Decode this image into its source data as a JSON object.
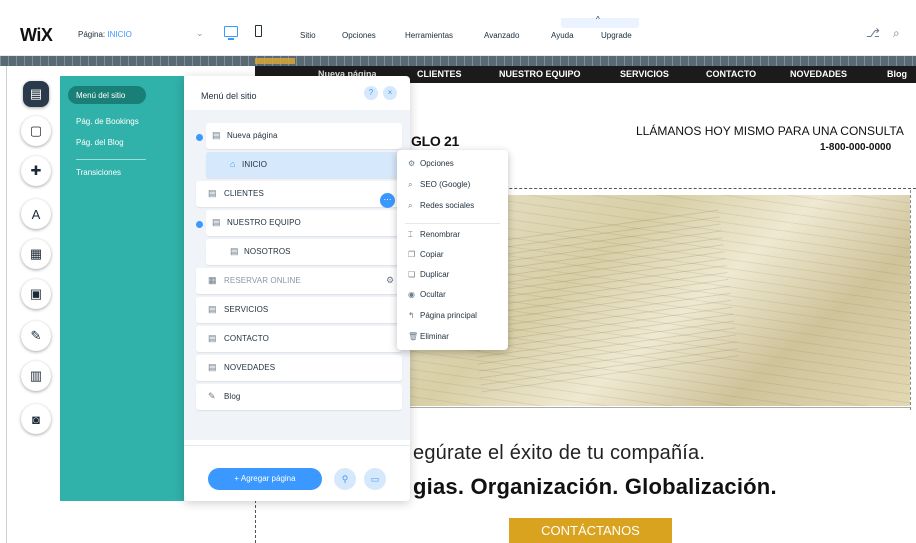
{
  "toolbar": {
    "logo": "WiX",
    "page_prefix": "Página:",
    "page_name": "INICIO",
    "menu": [
      "Sitio",
      "Opciones",
      "Herramientas",
      "Avanzado",
      "Ayuda",
      "Upgrade"
    ]
  },
  "site_nav": {
    "items": [
      "Nueva página",
      "CLIENTES",
      "NUESTRO EQUIPO",
      "SERVICIOS",
      "CONTACTO",
      "NOVEDADES",
      "Blog"
    ]
  },
  "teal_menu": {
    "items": [
      "Menú del sitio",
      "Pág. de Bookings",
      "Pág. del Blog",
      "Transiciones"
    ]
  },
  "panel": {
    "title": "Menú del sitio",
    "help": "?",
    "close": "×",
    "pages": [
      {
        "label": "Nueva página"
      },
      {
        "label": "INICIO"
      },
      {
        "label": "CLIENTES"
      },
      {
        "label": "NUESTRO EQUIPO"
      },
      {
        "label": "NOSOTROS"
      },
      {
        "label": "RESERVAR ONLINE"
      },
      {
        "label": "SERVICIOS"
      },
      {
        "label": "CONTACTO"
      },
      {
        "label": "NOVEDADES"
      },
      {
        "label": "Blog"
      }
    ],
    "add_page": "+ Agregar página"
  },
  "context_menu": {
    "items": [
      "Opciones",
      "SEO (Google)",
      "Redes sociales",
      "Renombrar",
      "Copiar",
      "Duplicar",
      "Ocultar",
      "Página principal",
      "Eliminar"
    ]
  },
  "site": {
    "header_partial": "GLO 21",
    "call_us": "LLÁMANOS HOY MISMO PARA UNA CONSULTA",
    "phone": "1-800-000-0000",
    "tagline1": "egúrate el éxito de tu compañía.",
    "tagline2": "gias. Organización. Globalización.",
    "cta": "CONTÁCTANOS"
  },
  "colors": {
    "accent": "#3b98ff",
    "teal": "#30b1a9",
    "cta": "#d9a320"
  }
}
